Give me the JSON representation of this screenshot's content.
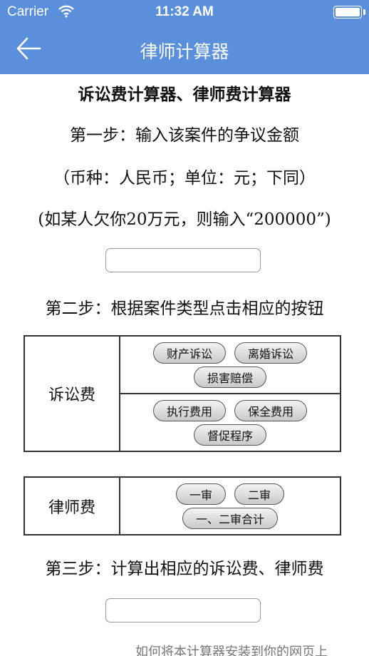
{
  "status_bar": {
    "carrier": "Carrier",
    "time": "11:32 AM"
  },
  "nav": {
    "title": "律师计算器",
    "back_icon": "back-arrow-icon"
  },
  "header_color": "#5a8fdc",
  "content": {
    "heading": "诉讼费计算器、律师费计算器",
    "step1": "第一步：输入该案件的争议金额",
    "step1_note": "（币种：人民币；单位：元；下同）",
    "step1_example": "(如某人欠你20万元，则输入“200000”)",
    "amount_input": {
      "value": "",
      "placeholder": ""
    },
    "step2": "第二步：根据案件类型点击相应的按钮",
    "litigation_fee": {
      "label": "诉讼费",
      "group1": [
        "财产诉讼",
        "离婚诉讼",
        "损害赔偿"
      ],
      "group2": [
        "执行费用",
        "保全费用",
        "督促程序"
      ]
    },
    "lawyer_fee": {
      "label": "律师费",
      "buttons": [
        "一审",
        "二审",
        "一、二审合计"
      ]
    },
    "step3": "第三步：计算出相应的诉讼费、律师费",
    "result_input": {
      "value": "",
      "placeholder": ""
    },
    "footer_link": "如何将本计算器安装到你的网页上"
  }
}
